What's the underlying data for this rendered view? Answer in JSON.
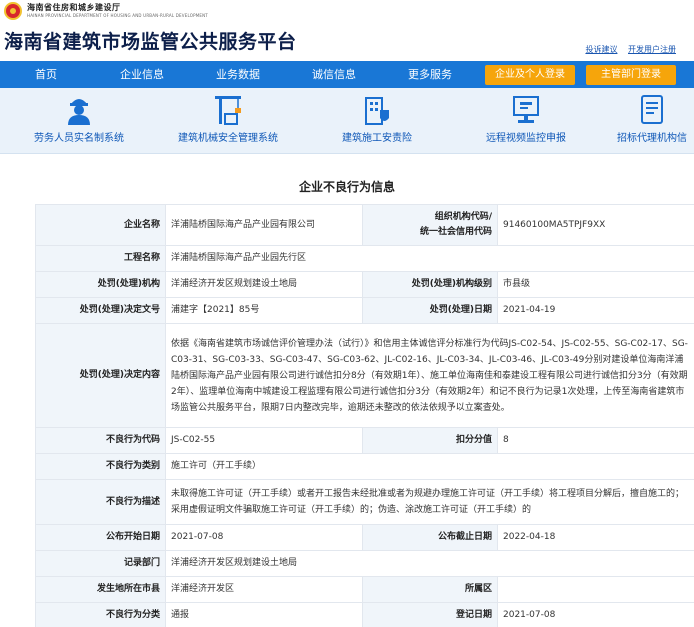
{
  "header": {
    "dept_cn": "海南省住房和城乡建设厅",
    "dept_en": "HAINAN PROVINCIAL DEPARTMENT OF HOUSING AND URBAN-RURAL DEVELOPMENT",
    "site_title": "海南省建筑市场监管公共服务平台",
    "links": [
      "投诉建议",
      "开发用户注册"
    ]
  },
  "nav": {
    "items": [
      "首页",
      "企业信息",
      "业务数据",
      "诚信信息",
      "更多服务"
    ],
    "buttons": [
      "企业及个人登录",
      "主管部门登录"
    ],
    "accent": "#1977d6",
    "button_color": "#f6a50b"
  },
  "services": [
    {
      "label": "劳务人员实名制系统",
      "icon": "worker-icon"
    },
    {
      "label": "建筑机械安全管理系统",
      "icon": "crane-icon"
    },
    {
      "label": "建筑施工安责险",
      "icon": "insurance-building-icon"
    },
    {
      "label": "远程视频监控申报",
      "icon": "video-monitor-icon"
    },
    {
      "label": "招标代理机构信",
      "icon": "document-icon"
    }
  ],
  "page_heading": "企业不良行为信息",
  "record": {
    "company_label": "企业名称",
    "company_value": "洋浦陆桥国际海产品产业园有限公司",
    "org_code_label_1": "组织机构代码/",
    "org_code_label_2": "统一社会信用代码",
    "org_code_value": "91460100MA5TPJF9XX",
    "project_label": "工程名称",
    "project_value": "洋浦陆桥国际海产品产业园先行区",
    "authority_label": "处罚(处理)机构",
    "authority_value": "洋浦经济开发区规划建设土地局",
    "level_label": "处罚(处理)机构级别",
    "level_value": "市县级",
    "decision_no_label": "处罚(处理)决定文号",
    "decision_no_value": "浦建字【2021】85号",
    "date_label": "处罚(处理)日期",
    "date_value": "2021-04-19",
    "content_label": "处罚(处理)决定内容",
    "content_value": "依据《海南省建筑市场诚信评价管理办法（试行）》和信用主体诚信评分标准行为代码JS-C02-54、JS-C02-55、SG-C02-17、SG-C03-31、SG-C03-33、SG-C03-47、SG-C03-62、JL-C02-16、JL-C03-34、JL-C03-46、JL-C03-49分别对建设单位海南洋浦陆桥国际海产品产业园有限公司进行诚信扣分8分（有效期1年）、施工单位海南佳和泰建设工程有限公司进行诚信扣分3分（有效期2年）、监理单位海南中城建设工程监理有限公司进行诚信扣分3分（有效期2年）和记不良行为记录1次处理，上传至海南省建筑市场监管公共服务平台，限期7日内整改完毕，逾期还未整改的依法依规予以立案查处。",
    "behavior_code_label": "不良行为代码",
    "behavior_code_value": "JS-C02-55",
    "score_label": "扣分分值",
    "score_value": "8",
    "category_label": "不良行为类别",
    "category_value": "施工许可（开工手续）",
    "description_label": "不良行为描述",
    "description_value": "未取得施工许可证（开工手续）或者开工报告未经批准或者为规避办理施工许可证（开工手续）将工程项目分解后，擅自施工的；采用虚假证明文件骗取施工许可证（开工手续）的；伪造、涂改施工许可证（开工手续）的",
    "publish_start_label": "公布开始日期",
    "publish_start_value": "2021-07-08",
    "publish_end_label": "公布截止日期",
    "publish_end_value": "2022-04-18",
    "recorder_label": "记录部门",
    "recorder_value": "洋浦经济开发区规划建设土地局",
    "location_label": "发生地所在市县",
    "location_value": "洋浦经济开发区",
    "district_label": "所属区",
    "district_value": "",
    "class_label": "不良行为分类",
    "class_value": "通报",
    "register_date_label": "登记日期",
    "register_date_value": "2021-07-08"
  }
}
